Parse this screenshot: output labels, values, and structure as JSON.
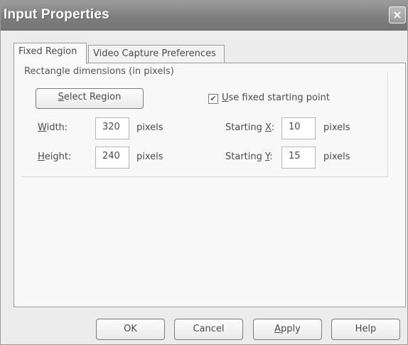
{
  "window": {
    "title": "Input Properties",
    "close_glyph": "×"
  },
  "tabs": [
    {
      "label": "Fixed Region",
      "selected": true
    },
    {
      "label": "Video Capture Preferences",
      "selected": false
    }
  ],
  "group": {
    "label": "Rectangle dimensions (in pixels)"
  },
  "select_region": {
    "label_prefix": "",
    "mnemonic": "S",
    "label_rest": "elect Region"
  },
  "fixed_start": {
    "checked": true,
    "check_glyph": "✔",
    "mnemonic": "U",
    "label_rest": "se fixed starting point"
  },
  "width": {
    "mnemonic": "W",
    "label_rest": "idth:",
    "value": "320",
    "unit": "pixels"
  },
  "height": {
    "mnemonic": "H",
    "label_rest": "eight:",
    "value": "240",
    "unit": "pixels"
  },
  "start_x": {
    "label_prefix": "Starting ",
    "mnemonic": "X",
    "label_suffix": ":",
    "value": "10",
    "unit": "pixels"
  },
  "start_y": {
    "label_prefix": "Starting ",
    "mnemonic": "Y",
    "label_suffix": ":",
    "value": "15",
    "unit": "pixels"
  },
  "buttons": {
    "ok": "OK",
    "cancel": "Cancel",
    "apply_mnemonic": "A",
    "apply_rest": "pply",
    "help": "Help"
  },
  "icons": {
    "close": "close-icon",
    "checkbox": "checkmark-icon"
  },
  "colors": {
    "titlebar": "#7e7e7e",
    "dialog_bg": "#ececec",
    "panel_bg": "#f8f8f8"
  }
}
